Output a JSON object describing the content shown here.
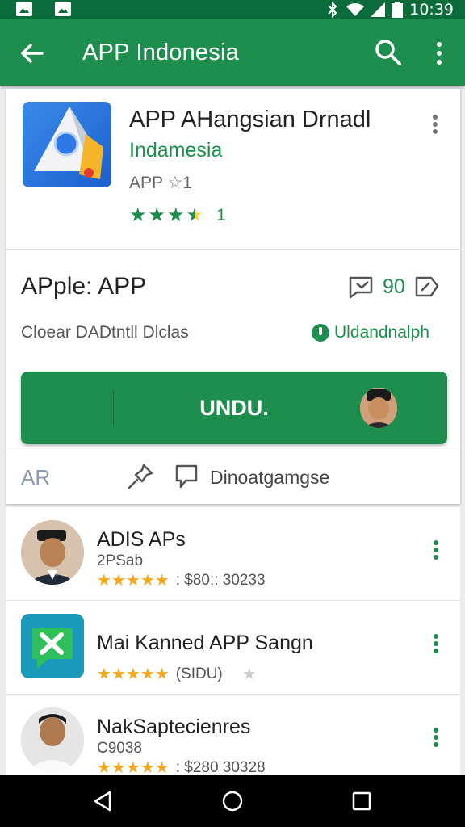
{
  "status_bar": {
    "time": "10:39",
    "icons": [
      "image-icon",
      "image-icon",
      "bluetooth-icon",
      "wifi-icon",
      "signal-icon",
      "battery-icon"
    ]
  },
  "app_bar": {
    "title": "APP Indonesia",
    "icons": [
      "back-arrow-icon",
      "search-icon",
      "more-vert-icon"
    ]
  },
  "app": {
    "name": "APP AHangsian Drnadl",
    "developer": "Indamesia",
    "meta": "APP ☆1",
    "rating_num": "1",
    "stars": 3.5
  },
  "section": {
    "title": "APple: APP",
    "count": "90",
    "subtitle": "Cloear DADtntll Dlclas",
    "verified_label": "Uldandnalph"
  },
  "install": {
    "label": "UNDU."
  },
  "actions": {
    "left_label": "AR",
    "comment_label": "Dinoatgamgse"
  },
  "list": [
    {
      "name": "ADIS APs",
      "sub": "2PSab",
      "stars": 4.5,
      "meta": ": $80:: 30233",
      "thumb": "person-avatar"
    },
    {
      "name": "Mai Kanned APP Sangn",
      "sub": "",
      "stars": 4.5,
      "meta": "(SIDU)",
      "thumb": "app-icon-green"
    },
    {
      "name": "NakSaptecienres",
      "sub": "C9038",
      "stars": 4.5,
      "meta": ": $280 30328",
      "thumb": "person-avatar"
    }
  ],
  "colors": {
    "status_bar": "#0b6b3a",
    "app_bar": "#1e8e4e",
    "accent": "#1e8e4e",
    "star_list": "#f2a91f"
  },
  "nav_bar": {
    "icons": [
      "back-triangle-icon",
      "home-circle-icon",
      "recents-square-icon"
    ]
  }
}
